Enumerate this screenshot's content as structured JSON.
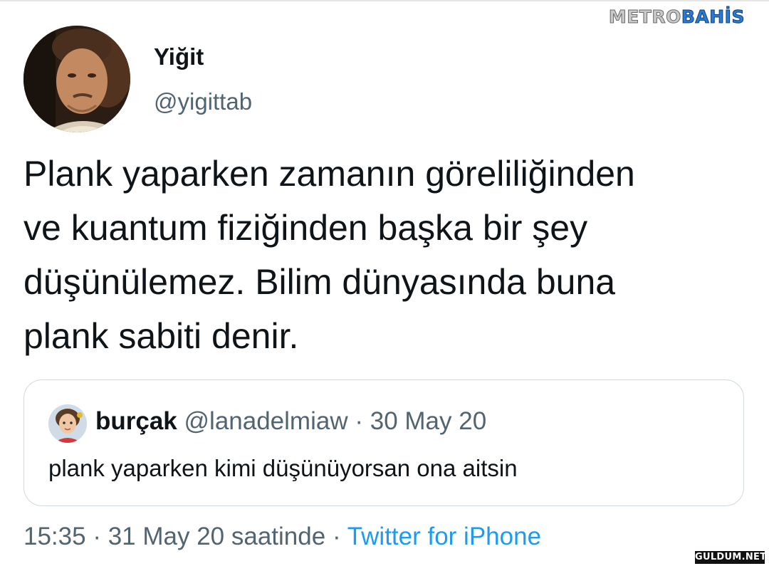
{
  "watermark": {
    "top_part1": "METRO",
    "top_part2": "BAHİS",
    "bottom": "GULDUM.NET"
  },
  "author": {
    "display_name": "Yiğit",
    "handle": "@yigittab"
  },
  "tweet": {
    "lines": [
      "Plank yaparken zamanın göreliliğinden",
      "ve kuantum fiziğinden başka bir şey",
      "düşünülemez. Bilim dünyasında buna",
      "plank sabiti denir."
    ]
  },
  "quoted_tweet": {
    "name": "burçak",
    "handle": "@lanadelmiaw",
    "separator": "·",
    "date": "30 May 20",
    "text": "plank yaparken kimi düşünüyorsan ona aitsin"
  },
  "meta": {
    "time": "15:35",
    "separator": "·",
    "date": "31 May 20 saatinde",
    "source": "Twitter for iPhone"
  },
  "colors": {
    "primary_text": "#0f1419",
    "secondary_text": "#536471",
    "link": "#1d9bf0",
    "border": "#cfd9de"
  }
}
